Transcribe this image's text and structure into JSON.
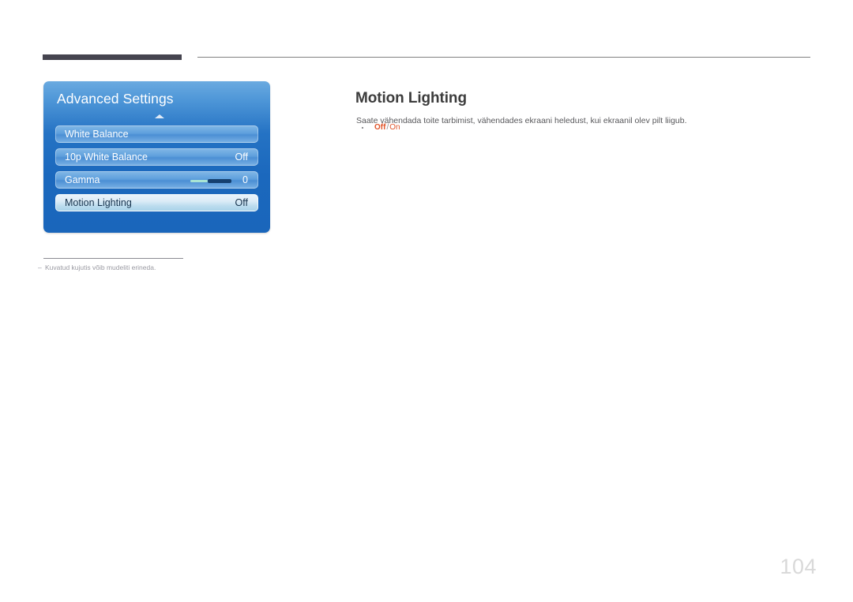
{
  "header": {
    "dark_bar": "",
    "rule": ""
  },
  "osd": {
    "title": "Advanced Settings",
    "collapse_arrow_icon": "triangle-up-icon",
    "rows": [
      {
        "label": "White Balance",
        "value": "",
        "selected": false,
        "has_slider": false
      },
      {
        "label": "10p White Balance",
        "value": "Off",
        "selected": false,
        "has_slider": false
      },
      {
        "label": "Gamma",
        "value": "0",
        "selected": false,
        "has_slider": true
      },
      {
        "label": "Motion Lighting",
        "value": "Off",
        "selected": true,
        "has_slider": false
      }
    ]
  },
  "footnote": {
    "dash": "‒",
    "text": "Kuvatud kujutis võib mudeliti erineda."
  },
  "content": {
    "heading": "Motion Lighting",
    "description": "Saate vähendada toite tarbimist, vähendades ekraani heledust, kui ekraanil olev pilt liigub.",
    "options": {
      "first": "Off",
      "separator": "/",
      "second": "On"
    }
  },
  "page": {
    "number": "104"
  },
  "colors": {
    "accent_orange": "#e0542a",
    "panel_blue": "#2573c4",
    "header_bar": "#45444f",
    "page_number": "#d9d9d9"
  }
}
